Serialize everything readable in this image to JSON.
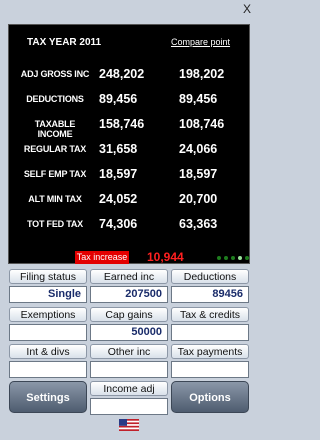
{
  "window": {
    "close_label": "X"
  },
  "display": {
    "tax_year": "TAX YEAR 2011",
    "compare_link": "Compare point",
    "rows": [
      {
        "label": "ADJ GROSS INC",
        "current": "248,202",
        "compare": "198,202"
      },
      {
        "label": "DEDUCTIONS",
        "current": "89,456",
        "compare": "89,456"
      },
      {
        "label": "TAXABLE INCOME",
        "current": "158,746",
        "compare": "108,746"
      },
      {
        "label": "REGULAR TAX",
        "current": "31,658",
        "compare": "24,066"
      },
      {
        "label": "SELF EMP TAX",
        "current": "18,597",
        "compare": "18,597"
      },
      {
        "label": "ALT MIN TAX",
        "current": "24,052",
        "compare": "20,700"
      },
      {
        "label": "TOT FED TAX",
        "current": "74,306",
        "compare": "63,363"
      }
    ],
    "tax_increase_label": "Tax increase",
    "tax_increase_value": "10,944",
    "page_dots_count": 5,
    "page_dots_active": 4
  },
  "fields": {
    "filing_status": {
      "label": "Filing status",
      "value": "Single"
    },
    "earned_inc": {
      "label": "Earned inc",
      "value": "207500"
    },
    "deductions": {
      "label": "Deductions",
      "value": "89456"
    },
    "exemptions": {
      "label": "Exemptions",
      "value": ""
    },
    "cap_gains": {
      "label": "Cap gains",
      "value": "50000"
    },
    "tax_credits": {
      "label": "Tax & credits",
      "value": ""
    },
    "int_divs": {
      "label": "Int & divs",
      "value": ""
    },
    "other_inc": {
      "label": "Other inc",
      "value": ""
    },
    "tax_payments": {
      "label": "Tax payments",
      "value": ""
    },
    "income_adj": {
      "label": "Income adj",
      "value": ""
    }
  },
  "buttons": {
    "settings": "Settings",
    "options": "Options"
  },
  "icons": {
    "flag": "us-flag-icon"
  }
}
